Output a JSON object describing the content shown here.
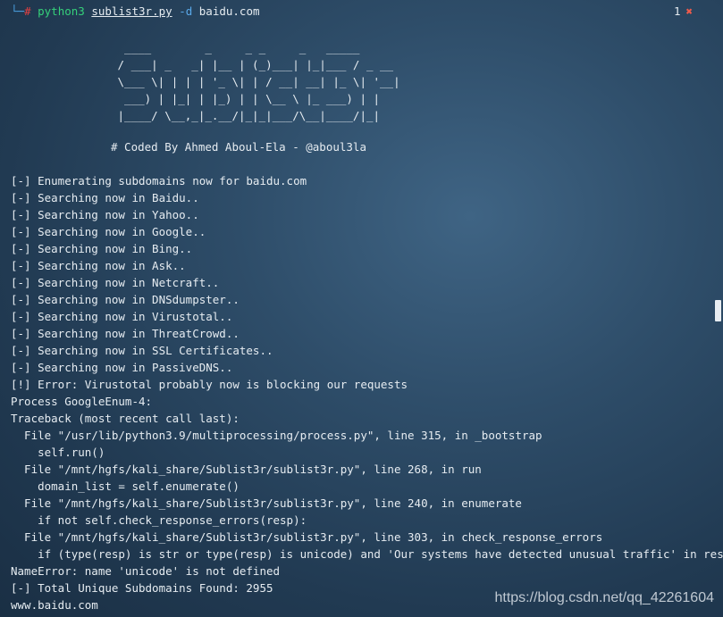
{
  "prompt": {
    "tree": "└─",
    "hash": "#",
    "command": "python3",
    "script": "sublist3r.py",
    "flag": "-d",
    "domain": "baidu.com"
  },
  "job": {
    "count": "1",
    "error_mark": "✖"
  },
  "banner": {
    "lines": [
      "  ____        _     _ _     _   _____",
      " / ___| _   _| |__ | (_)___| |_|___ / _ __",
      " \\___ \\| | | | '_ \\| | / __| __| |_ \\| '__|",
      "  ___) | |_| | |_) | | \\__ \\ |_ ___) | |",
      " |____/ \\__,_|_.__/|_|_|___/\\__|____/|_|"
    ],
    "credit": "# Coded By Ahmed Aboul-Ela - @aboul3la"
  },
  "output": {
    "lines": [
      "[-] Enumerating subdomains now for baidu.com",
      "[-] Searching now in Baidu..",
      "[-] Searching now in Yahoo..",
      "[-] Searching now in Google..",
      "[-] Searching now in Bing..",
      "[-] Searching now in Ask..",
      "[-] Searching now in Netcraft..",
      "[-] Searching now in DNSdumpster..",
      "[-] Searching now in Virustotal..",
      "[-] Searching now in ThreatCrowd..",
      "[-] Searching now in SSL Certificates..",
      "[-] Searching now in PassiveDNS..",
      "[!] Error: Virustotal probably now is blocking our requests",
      "Process GoogleEnum-4:",
      "Traceback (most recent call last):",
      "  File \"/usr/lib/python3.9/multiprocessing/process.py\", line 315, in _bootstrap",
      "    self.run()",
      "  File \"/mnt/hgfs/kali_share/Sublist3r/sublist3r.py\", line 268, in run",
      "    domain_list = self.enumerate()",
      "  File \"/mnt/hgfs/kali_share/Sublist3r/sublist3r.py\", line 240, in enumerate",
      "    if not self.check_response_errors(resp):",
      "  File \"/mnt/hgfs/kali_share/Sublist3r/sublist3r.py\", line 303, in check_response_errors",
      "    if (type(resp) is str or type(resp) is unicode) and 'Our systems have detected unusual traffic' in resp:",
      "NameError: name 'unicode' is not defined",
      "[-] Total Unique Subdomains Found: 2955",
      "www.baidu.com"
    ]
  },
  "watermark": "https://blog.csdn.net/qq_42261604"
}
